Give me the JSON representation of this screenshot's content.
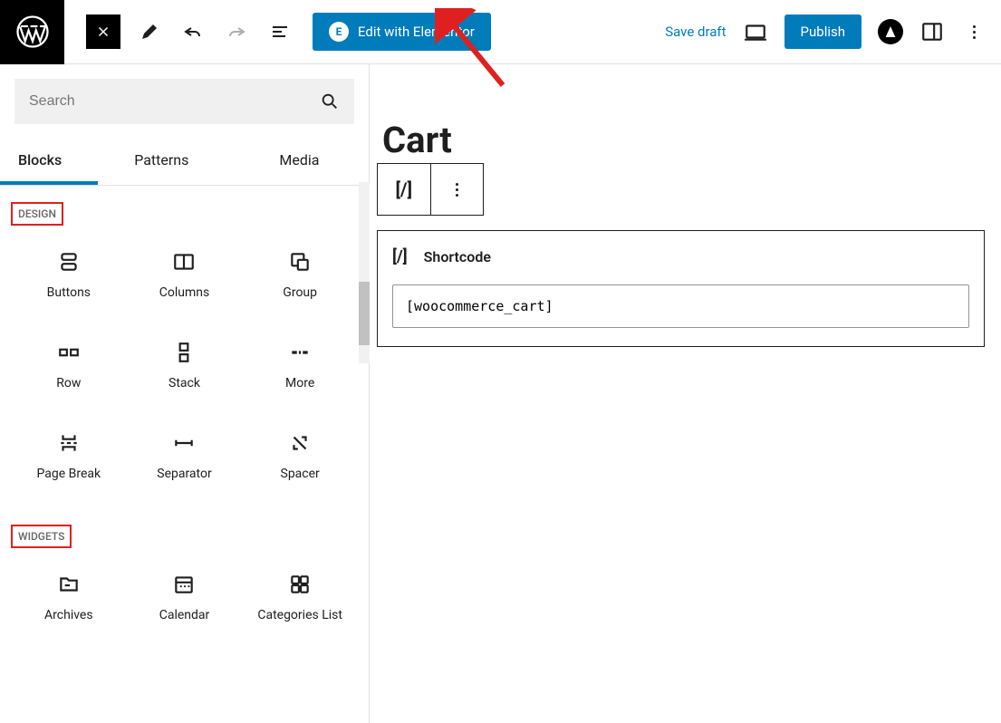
{
  "topbar": {
    "elementor_label": "Edit with Elementor",
    "save_draft": "Save draft",
    "publish": "Publish"
  },
  "sidebar": {
    "search_placeholder": "Search",
    "tabs": {
      "blocks": "Blocks",
      "patterns": "Patterns",
      "media": "Media"
    },
    "sections": {
      "design": {
        "label": "DESIGN",
        "items": [
          {
            "name": "buttons",
            "label": "Buttons"
          },
          {
            "name": "columns",
            "label": "Columns"
          },
          {
            "name": "group",
            "label": "Group"
          },
          {
            "name": "row",
            "label": "Row"
          },
          {
            "name": "stack",
            "label": "Stack"
          },
          {
            "name": "more",
            "label": "More"
          },
          {
            "name": "page-break",
            "label": "Page Break"
          },
          {
            "name": "separator",
            "label": "Separator"
          },
          {
            "name": "spacer",
            "label": "Spacer"
          }
        ]
      },
      "widgets": {
        "label": "WIDGETS",
        "items": [
          {
            "name": "archives",
            "label": "Archives"
          },
          {
            "name": "calendar",
            "label": "Calendar"
          },
          {
            "name": "categories-list",
            "label": "Categories List"
          }
        ]
      }
    }
  },
  "canvas": {
    "title": "Cart",
    "shortcode_icon": "[/]",
    "shortcode_label": "Shortcode",
    "shortcode_value": "[woocommerce_cart]"
  },
  "colors": {
    "primary": "#007cba",
    "highlight": "#e02020"
  }
}
